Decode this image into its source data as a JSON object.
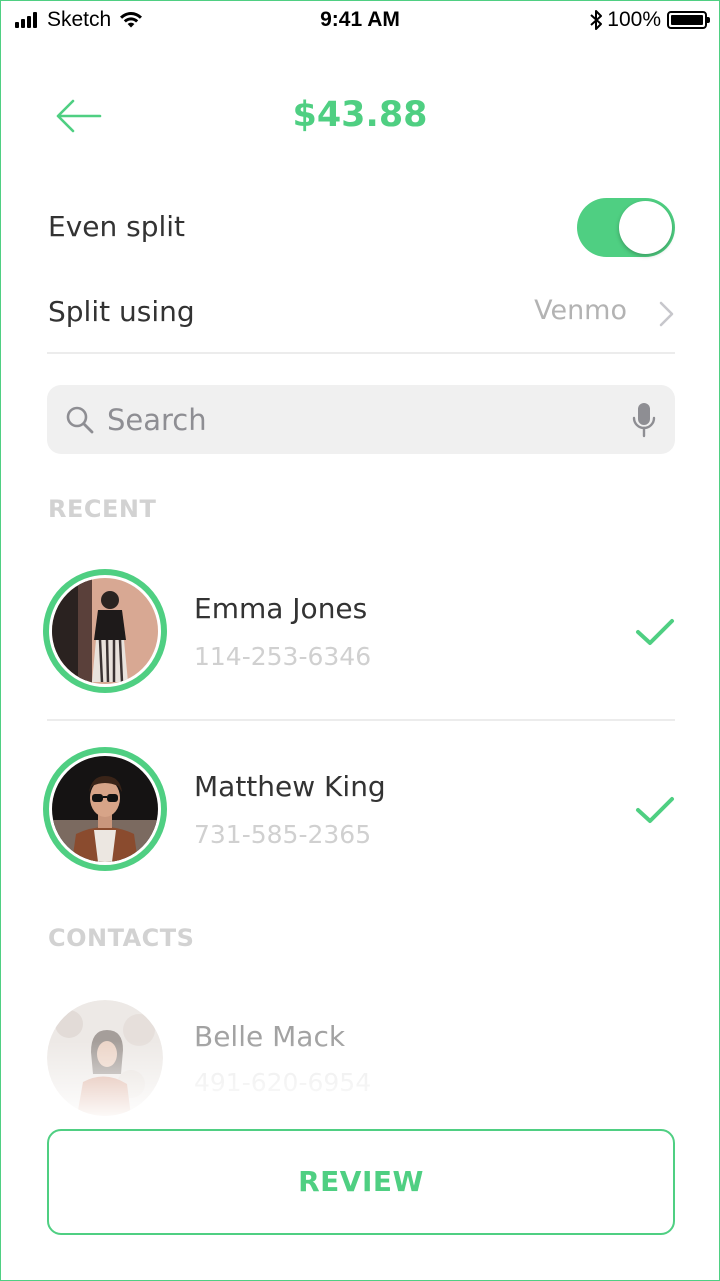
{
  "status_bar": {
    "carrier": "Sketch",
    "time": "9:41 AM",
    "battery_percent": "100%",
    "battery_level": 1.0,
    "icons": [
      "signal-icon",
      "wifi-icon",
      "bluetooth-icon",
      "battery-icon"
    ]
  },
  "header": {
    "back_icon": "arrow-left-icon",
    "amount": "$43.88"
  },
  "settings": {
    "even_split_label": "Even split",
    "even_split_on": true,
    "split_using_label": "Split using",
    "split_using_value": "Venmo"
  },
  "search": {
    "placeholder": "Search",
    "value": ""
  },
  "sections": {
    "recent": "RECENT",
    "contacts": "CONTACTS"
  },
  "recent": [
    {
      "name": "Emma Jones",
      "phone": "114-253-6346",
      "selected": true
    },
    {
      "name": "Matthew King",
      "phone": "731-585-2365",
      "selected": true
    }
  ],
  "contacts": [
    {
      "name": "Belle Mack",
      "phone": "491-620-6954",
      "selected": false
    }
  ],
  "actions": {
    "review_label": "REVIEW"
  },
  "colors": {
    "accent": "#4fcf82",
    "muted_text": "#b3b3b3",
    "divider": "#ececec",
    "search_bg": "#f0f0f0"
  }
}
